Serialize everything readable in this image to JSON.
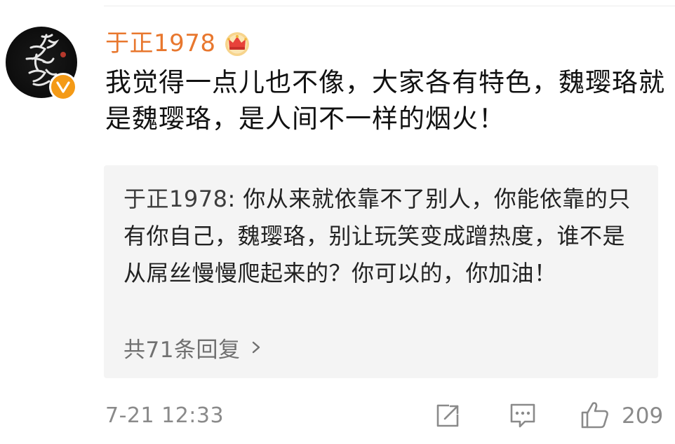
{
  "comment": {
    "username": "于正1978",
    "text": "我觉得一点儿也不像，大家各有特色，魏璎珞就是魏璎珞，是人间不一样的烟火！",
    "reply": {
      "author": "于正1978",
      "separator": ": ",
      "text": "你从来就依靠不了别人，你能依靠的只有你自己，魏璎珞，别让玩笑变成蹭热度，谁不是从屌丝慢慢爬起来的？你可以的，你加油！"
    },
    "reply_count": "共71条回复",
    "timestamp": "7-21 12:33",
    "like_count": "209"
  },
  "icons": {
    "avatar": "calligraphy-avatar",
    "verified": "verified-v-icon",
    "crown": "crown-badge-icon",
    "chevron": "chevron-right-icon",
    "share": "share-icon",
    "comment": "comment-icon",
    "like": "thumbs-up-icon"
  },
  "colors": {
    "username": "#e8772e",
    "verified_badge": "#f49a16",
    "reply_background": "#f4f4f4",
    "muted": "#8a8a8a"
  }
}
